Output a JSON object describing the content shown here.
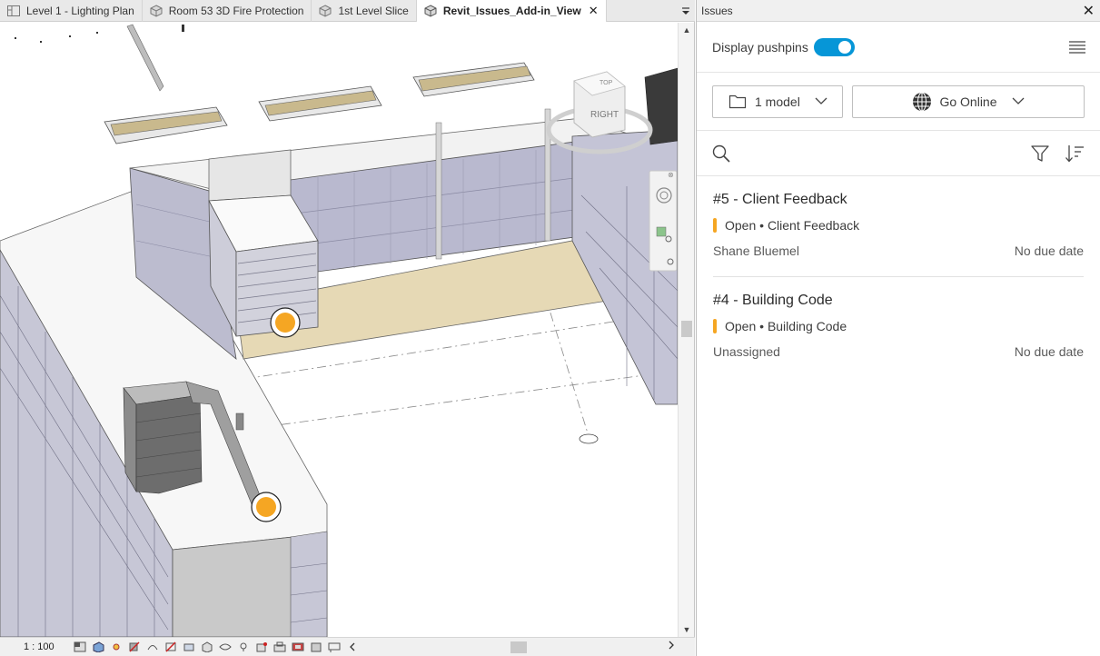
{
  "tabs": [
    {
      "label": "Level 1 - Lighting Plan",
      "icon": "floor-plan-icon",
      "active": false
    },
    {
      "label": "Room 53 3D Fire Protection",
      "icon": "3d-view-icon",
      "active": false
    },
    {
      "label": "1st Level Slice",
      "icon": "3d-view-icon",
      "active": false
    },
    {
      "label": "Revit_Issues_Add-in_View",
      "icon": "3d-view-icon",
      "active": true
    }
  ],
  "viewcube": {
    "face_label": "RIGHT",
    "top_label": "TOP"
  },
  "status": {
    "scale": "1 : 100"
  },
  "panel": {
    "title": "Issues",
    "display_pushpins_label": "Display pushpins",
    "pushpins_on": true,
    "model_dropdown_label": "1 model",
    "online_dropdown_label": "Go Online"
  },
  "issues": [
    {
      "title": "#5 - Client Feedback",
      "status": "Open",
      "type": "Client Feedback",
      "assignee": "Shane Bluemel",
      "due": "No due date",
      "status_color": "#f5a623"
    },
    {
      "title": "#4 - Building Code",
      "status": "Open",
      "type": "Building Code",
      "assignee": "Unassigned",
      "due": "No due date",
      "status_color": "#f5a623"
    }
  ],
  "colors": {
    "accent": "#0696d7",
    "pushpin": "#f5a623"
  }
}
